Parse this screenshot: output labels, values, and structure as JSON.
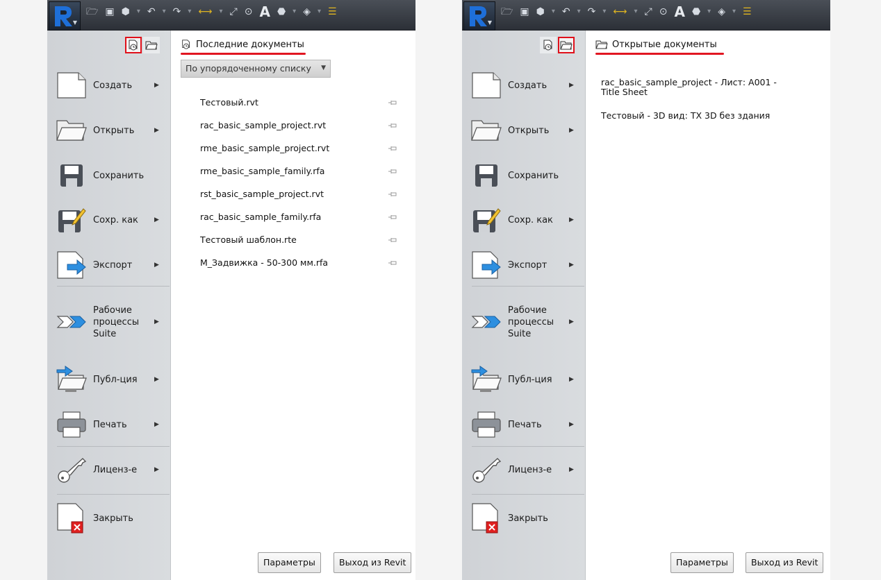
{
  "menu": {
    "create": "Создать",
    "open": "Открыть",
    "save": "Сохранить",
    "save_as": "Сохр. как",
    "export": "Экспорт",
    "workflows_1": "Рабочие",
    "workflows_2": "процессы",
    "workflows_3": "Suite",
    "publish": "Публ-ция",
    "print": "Печать",
    "license": "Лиценз-е",
    "close": "Закрыть"
  },
  "left": {
    "title": "Последние документы",
    "sort_label": "По упорядоченному списку",
    "recent_docs": [
      "Тестовый.rvt",
      "rac_basic_sample_project.rvt",
      "rme_basic_sample_project.rvt",
      "rme_basic_sample_family.rfa",
      "rst_basic_sample_project.rvt",
      "rac_basic_sample_family.rfa",
      "Тестовый шаблон.rte",
      "M_Задвижка - 50-300 мм.rfa"
    ],
    "selected_view": "recent-documents"
  },
  "right": {
    "title": "Открытые документы",
    "open_docs": [
      "rac_basic_sample_project - Лист: A001 -",
      "Title Sheet",
      "Тестовый - 3D вид: TX 3D без здания"
    ],
    "selected_view": "open-documents"
  },
  "buttons": {
    "options": "Параметры",
    "exit": "Выход из Revit"
  },
  "colors": {
    "highlight_red": "#e0101a",
    "toolbar_dark": "#2c3037",
    "rail_grey": "#d5d8db"
  }
}
